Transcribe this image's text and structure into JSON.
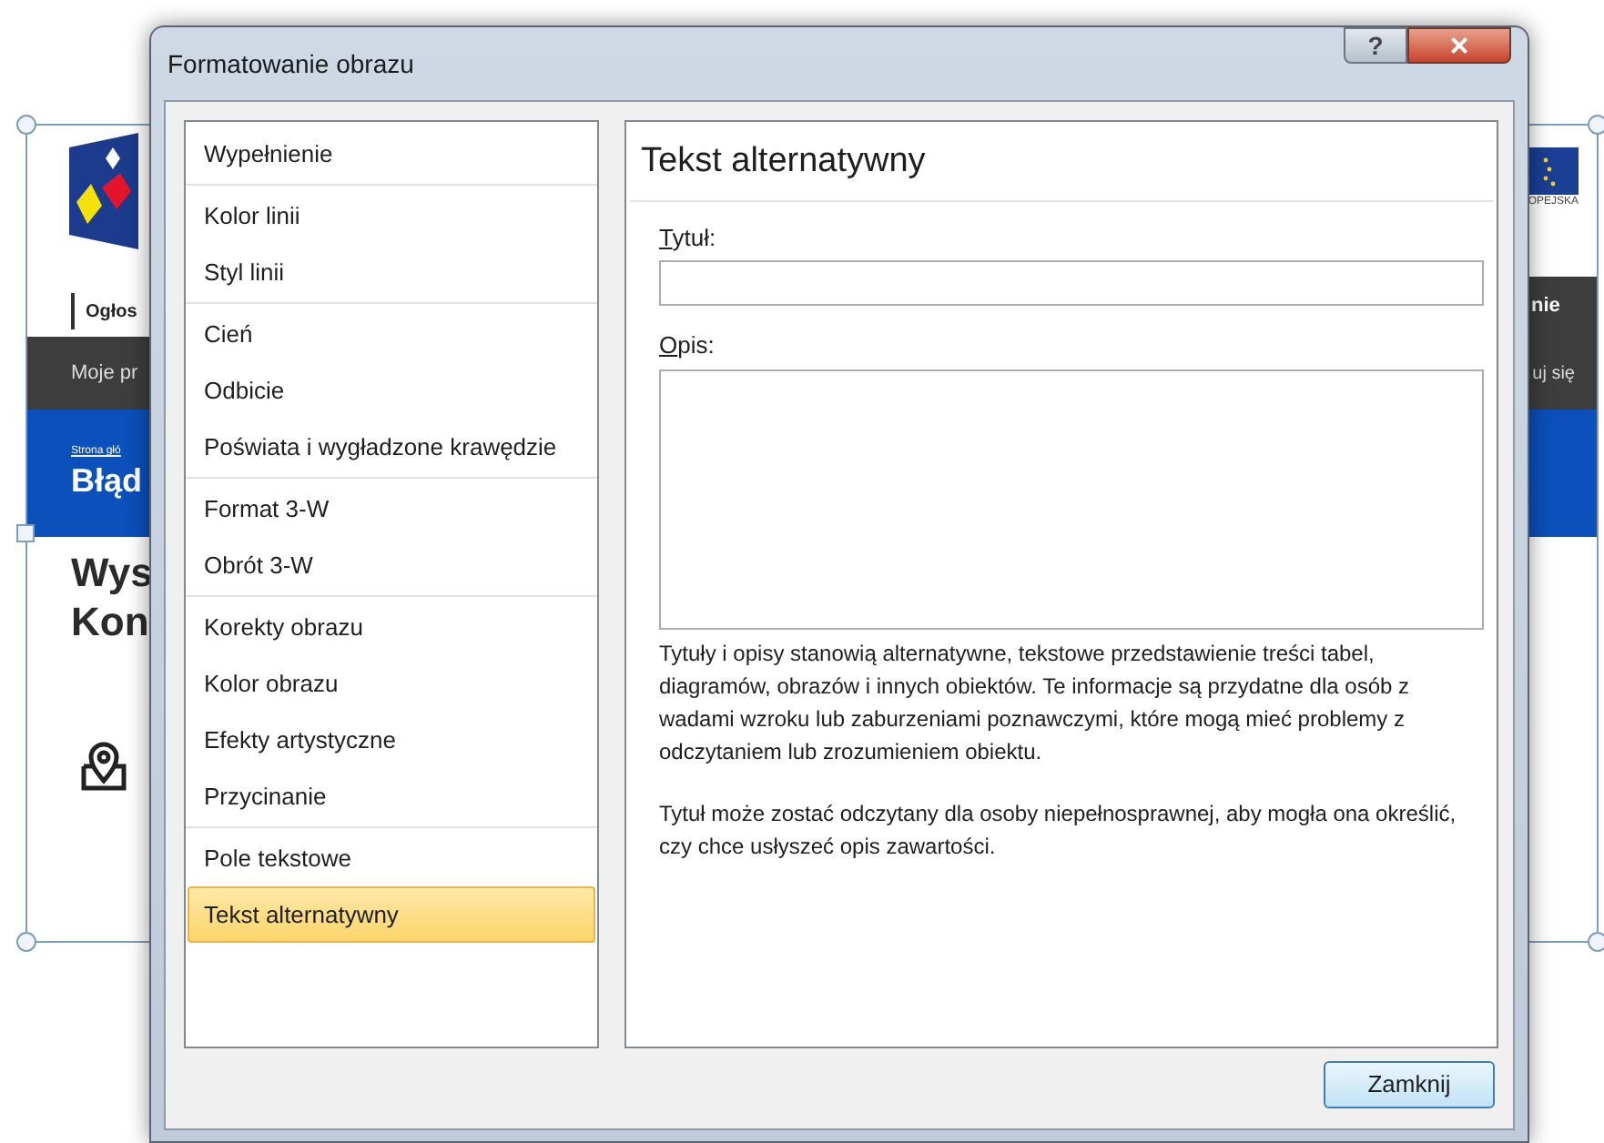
{
  "background_page": {
    "logo_caption": "OPEJSKA",
    "header_left": "Ogłos",
    "tab_right": "nie",
    "nav_left": "Moje pr",
    "nav_right": "uj się",
    "breadcrumb": "Strona głó",
    "banner_title": "Błąd",
    "heading_lines": [
      "Wys",
      "Kon"
    ]
  },
  "dialog": {
    "title": "Formatowanie obrazu",
    "help_button": "?",
    "close_glyph": "×",
    "category_groups": [
      [
        {
          "label": "Wypełnienie",
          "selected": false
        }
      ],
      [
        {
          "label": "Kolor linii",
          "selected": false
        },
        {
          "label": "Styl linii",
          "selected": false
        }
      ],
      [
        {
          "label": "Cień",
          "selected": false
        },
        {
          "label": "Odbicie",
          "selected": false
        },
        {
          "label": "Poświata i wygładzone krawędzie",
          "selected": false
        }
      ],
      [
        {
          "label": "Format 3-W",
          "selected": false
        },
        {
          "label": "Obrót 3-W",
          "selected": false
        }
      ],
      [
        {
          "label": "Korekty obrazu",
          "selected": false
        },
        {
          "label": "Kolor obrazu",
          "selected": false
        },
        {
          "label": "Efekty artystyczne",
          "selected": false
        },
        {
          "label": "Przycinanie",
          "selected": false
        }
      ],
      [
        {
          "label": "Pole tekstowe",
          "selected": false
        },
        {
          "label": "Tekst alternatywny",
          "selected": true
        }
      ]
    ],
    "panel": {
      "heading": "Tekst alternatywny",
      "title_label": "Tytuł:",
      "description_label": "Opis:",
      "help_paragraphs": [
        "Tytuły i opisy stanowią alternatywne, tekstowe przedstawienie treści tabel, diagramów, obrazów i innych obiektów. Te informacje są przydatne dla osób z wadami wzroku lub zaburzeniami poznawczymi, które mogą mieć problemy z odczytaniem lub zrozumieniem obiektu.",
        "Tytuł może zostać odczytany dla osoby niepełnosprawnej, aby mogła ona określić, czy chce usłyszeć opis zawartości."
      ]
    },
    "close_button": "Zamknij"
  }
}
